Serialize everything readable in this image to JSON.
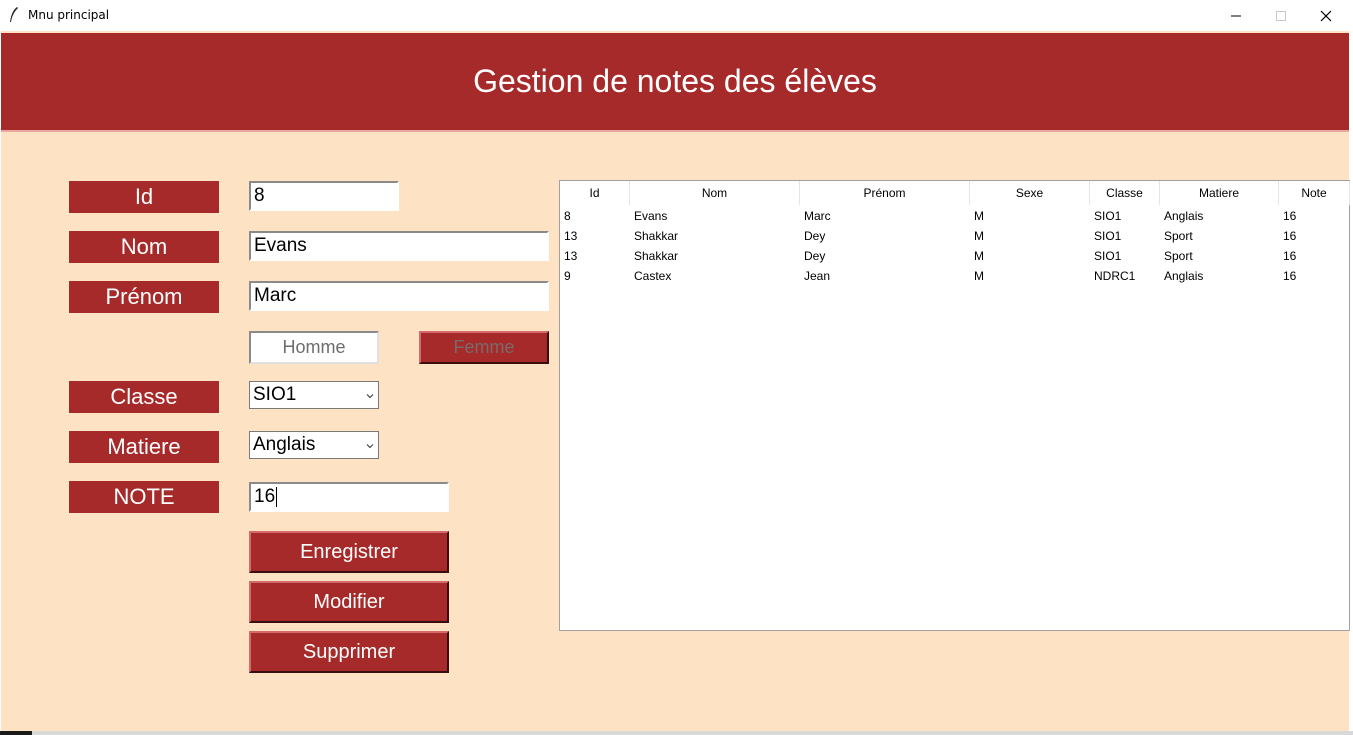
{
  "window": {
    "title": "Mnu principal",
    "controls": {
      "minimize_icon": "minimize-icon",
      "maximize_icon": "maximize-icon",
      "close_icon": "close-icon"
    }
  },
  "header": {
    "title": "Gestion de notes des élèves"
  },
  "form": {
    "labels": {
      "id": "Id",
      "nom": "Nom",
      "prenom": "Prénom",
      "classe": "Classe",
      "matiere": "Matiere",
      "note": "NOTE"
    },
    "values": {
      "id": "8",
      "nom": "Evans",
      "prenom": "Marc",
      "classe": "SIO1",
      "matiere": "Anglais",
      "note": "16"
    },
    "sexe": {
      "homme": "Homme",
      "femme": "Femme",
      "selected": "Homme"
    }
  },
  "buttons": {
    "enregistrer": "Enregistrer",
    "modifier": "Modifier",
    "supprimer": "Supprimer"
  },
  "table": {
    "columns": [
      "Id",
      "Nom",
      "Prénom",
      "Sexe",
      "Classe",
      "Matiere",
      "Note"
    ],
    "rows": [
      [
        "8",
        "Evans",
        "Marc",
        "M",
        "SIO1",
        "Anglais",
        "16"
      ],
      [
        "13",
        "Shakkar",
        "Dey",
        "M",
        "SIO1",
        "Sport",
        "16"
      ],
      [
        "13",
        "Shakkar",
        "Dey",
        "M",
        "SIO1",
        "Sport",
        "16"
      ],
      [
        "9",
        "Castex",
        "Jean",
        "M",
        "NDRC1",
        "Anglais",
        "16"
      ]
    ]
  },
  "colors": {
    "accent": "#a72a2b",
    "background": "#fde2c3"
  }
}
